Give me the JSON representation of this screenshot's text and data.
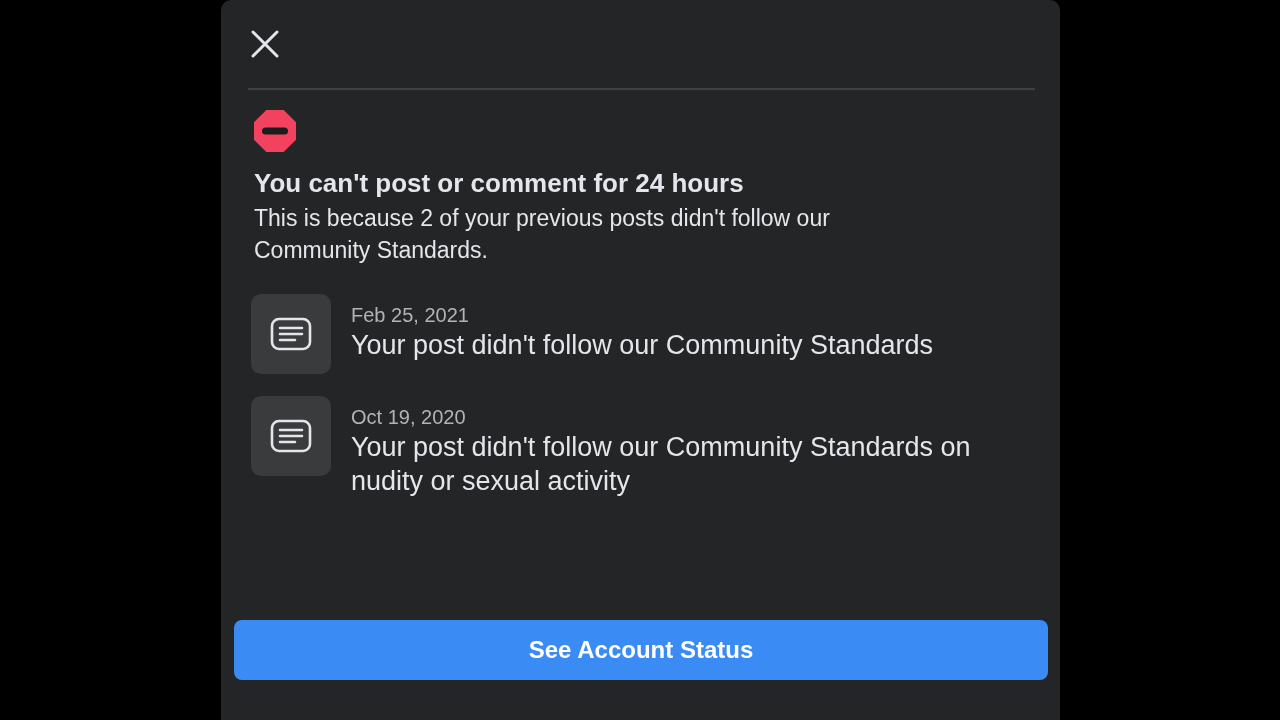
{
  "title": "You can't post or comment for 24 hours",
  "description": "This is because 2 of your previous posts didn't follow our Community Standards.",
  "violations": [
    {
      "date": "Feb 25, 2021",
      "text": "Your post didn't follow our Community Standards"
    },
    {
      "date": "Oct 19, 2020",
      "text": "Your post didn't follow our Community Standards on nudity or sexual activity"
    }
  ],
  "button": "See Account Status"
}
